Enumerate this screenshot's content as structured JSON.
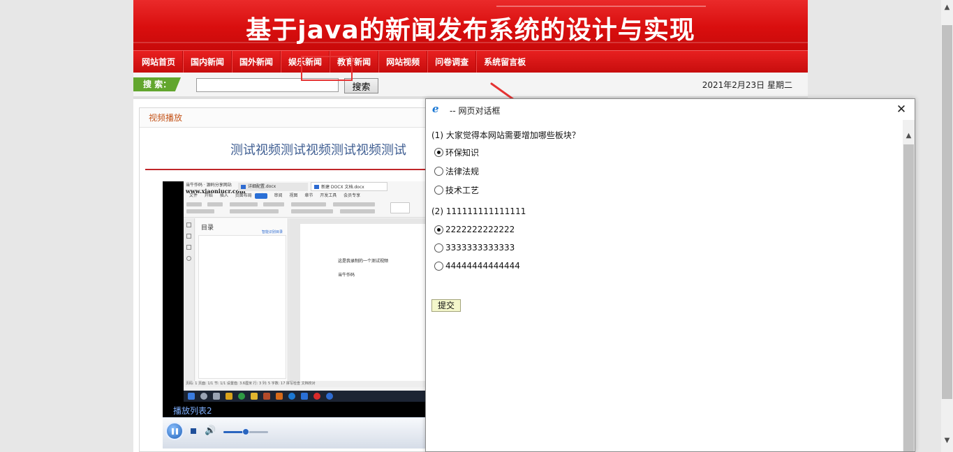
{
  "site": {
    "banner_title": "基于java的新闻发布系统的设计与实现",
    "nav": [
      "网站首页",
      "国内新闻",
      "国外新闻",
      "娱乐新闻",
      "教育新闻",
      "网站视频",
      "问卷调查",
      "系统留言板"
    ],
    "search": {
      "label": "搜 索：",
      "value": "",
      "button": "搜索"
    },
    "date": "2021年2月23日 星期二"
  },
  "content": {
    "section_title": "视频播放",
    "video_title": "测试视频测试视频测试视频测试",
    "player": {
      "screen": {
        "brand": "当牛作码 · 源码分享网站",
        "url": "www.xiaoniucr.com",
        "tab1": "详细配置.docx",
        "tab2": "新建 DOCX 文档.docx",
        "ribbon": "文件 开始 插入 页面布局 引用 审阅 视图 章节 开发工具 会员专享",
        "toc_title": "目录",
        "toc_link": "智能识别目录",
        "doc_line1": "这是我录制的一个测试视频",
        "doc_line2": "当牛作码",
        "status": "页码: 1  页面: 1/1  节: 1/1  设置值: 3.6厘米  行: 3  列: 5  字数: 17  拼写检查  文档校对"
      },
      "playlist_label": "播放列表2",
      "volume_level": 0.5
    }
  },
  "dialog": {
    "title": "-- 网页对话框",
    "questions": [
      {
        "text": "(1) 大家觉得本网站需要增加哪些板块？",
        "options": [
          {
            "label": "环保知识",
            "checked": true
          },
          {
            "label": "法律法规",
            "checked": false
          },
          {
            "label": "技术工艺",
            "checked": false
          }
        ]
      },
      {
        "text": "(2) 111111111111111",
        "options": [
          {
            "label": "2222222222222",
            "checked": true
          },
          {
            "label": "3333333333333",
            "checked": false
          },
          {
            "label": "44444444444444",
            "checked": false
          }
        ]
      }
    ],
    "submit": "提交"
  },
  "colors": {
    "brand_red": "#d90e0e",
    "search_green": "#62a62e",
    "title_blue": "#3f5e92",
    "section_orange": "#c4541a",
    "annotation_red": "#e53333"
  }
}
